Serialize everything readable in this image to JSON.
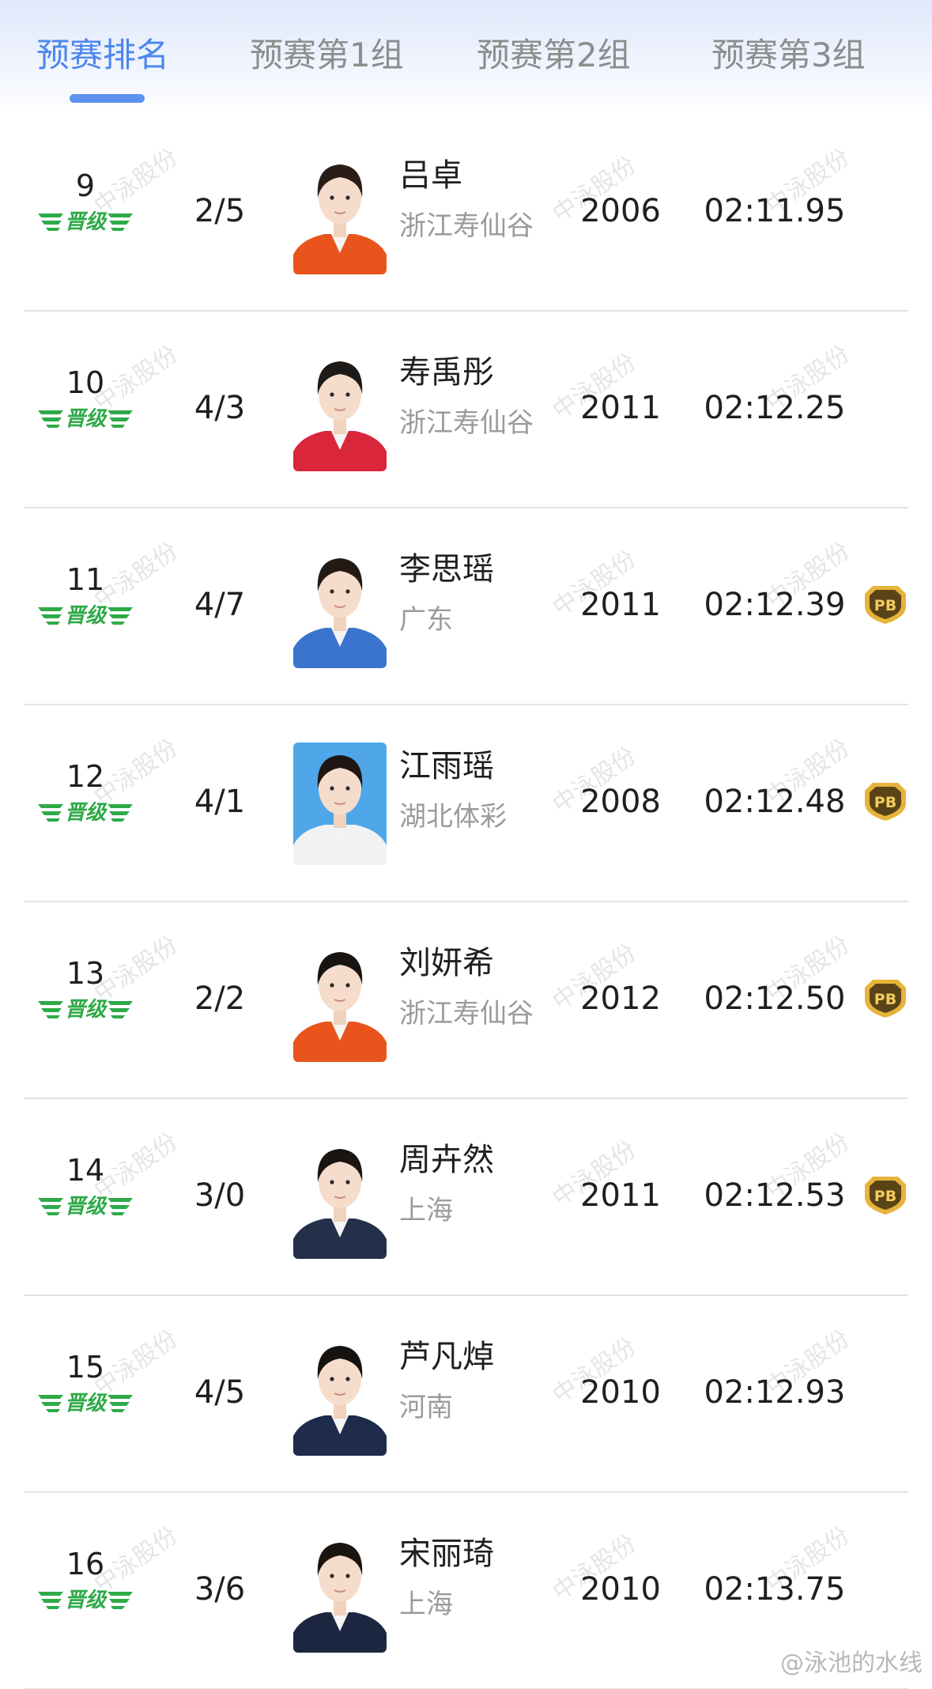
{
  "tabs": [
    {
      "label": "预赛排名",
      "active": true
    },
    {
      "label": "预赛第1组",
      "active": false
    },
    {
      "label": "预赛第2组",
      "active": false
    },
    {
      "label": "预赛第3组",
      "active": false
    }
  ],
  "colors": {
    "accent": "#4b87ec",
    "qualify_badge": "#2eaa48",
    "pb_badge": "#d9a528"
  },
  "qualify_label": "晋级",
  "pb_label": "PB",
  "watermark": "中泳股份",
  "rows": [
    {
      "rank": "9",
      "lane": "2/5",
      "name": "吕卓",
      "team": "浙江寿仙谷",
      "year": "2006",
      "time": "02:11.95",
      "pb": false,
      "avatar": {
        "bg": "#ffffff",
        "shirt": "#e8541c",
        "hair": "#2a1c16"
      }
    },
    {
      "rank": "10",
      "lane": "4/3",
      "name": "寿禹彤",
      "team": "浙江寿仙谷",
      "year": "2011",
      "time": "02:12.25",
      "pb": false,
      "avatar": {
        "bg": "#ffffff",
        "shirt": "#d9263a",
        "hair": "#1d1a18"
      }
    },
    {
      "rank": "11",
      "lane": "4/7",
      "name": "李思瑶",
      "team": "广东",
      "year": "2011",
      "time": "02:12.39",
      "pb": true,
      "avatar": {
        "bg": "#ffffff",
        "shirt": "#3a74cf",
        "hair": "#241a14"
      }
    },
    {
      "rank": "12",
      "lane": "4/1",
      "name": "江雨瑶",
      "team": "湖北体彩",
      "year": "2008",
      "time": "02:12.48",
      "pb": true,
      "avatar": {
        "bg": "#4fa6e8",
        "shirt": "#f2f2f2",
        "hair": "#1e1612"
      }
    },
    {
      "rank": "13",
      "lane": "2/2",
      "name": "刘妍希",
      "team": "浙江寿仙谷",
      "year": "2012",
      "time": "02:12.50",
      "pb": true,
      "avatar": {
        "bg": "#ffffff",
        "shirt": "#e8541c",
        "hair": "#181412"
      }
    },
    {
      "rank": "14",
      "lane": "3/0",
      "name": "周卉然",
      "team": "上海",
      "year": "2011",
      "time": "02:12.53",
      "pb": true,
      "avatar": {
        "bg": "#ffffff",
        "shirt": "#24304a",
        "hair": "#1a1412"
      }
    },
    {
      "rank": "15",
      "lane": "4/5",
      "name": "芦凡焯",
      "team": "河南",
      "year": "2010",
      "time": "02:12.93",
      "pb": false,
      "avatar": {
        "bg": "#ffffff",
        "shirt": "#1f2b4a",
        "hair": "#151210"
      }
    },
    {
      "rank": "16",
      "lane": "3/6",
      "name": "宋丽琦",
      "team": "上海",
      "year": "2010",
      "time": "02:13.75",
      "pb": false,
      "avatar": {
        "bg": "#ffffff",
        "shirt": "#1d2640",
        "hair": "#1b1512"
      }
    }
  ],
  "credit": "@泳池的水线"
}
